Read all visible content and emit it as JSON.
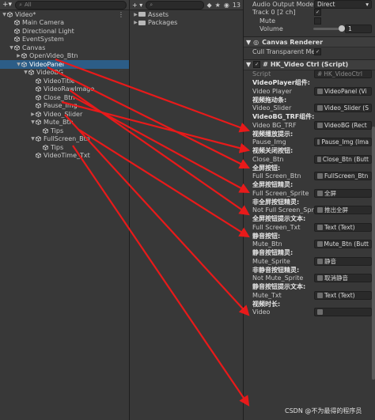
{
  "hierarchy": {
    "search_placeholder": "All",
    "rows": [
      {
        "label": "Video*",
        "depth": 0,
        "arrow": "▼",
        "icon": "scene",
        "selected": false
      },
      {
        "label": "Main Camera",
        "depth": 1,
        "arrow": "",
        "icon": "cube",
        "selected": false
      },
      {
        "label": "Directional Light",
        "depth": 1,
        "arrow": "",
        "icon": "cube",
        "selected": false
      },
      {
        "label": "EventSystem",
        "depth": 1,
        "arrow": "",
        "icon": "cube",
        "selected": false
      },
      {
        "label": "Canvas",
        "depth": 1,
        "arrow": "▼",
        "icon": "cube",
        "selected": false
      },
      {
        "label": "OpenVideo_Btn",
        "depth": 2,
        "arrow": "▶",
        "icon": "cube",
        "selected": false
      },
      {
        "label": "VideoPanel",
        "depth": 2,
        "arrow": "▼",
        "icon": "cube",
        "selected": true
      },
      {
        "label": "VideoBG",
        "depth": 3,
        "arrow": "▼",
        "icon": "cube",
        "selected": false
      },
      {
        "label": "VideoTitle",
        "depth": 4,
        "arrow": "",
        "icon": "cube",
        "selected": false
      },
      {
        "label": "VideoRawImage",
        "depth": 4,
        "arrow": "",
        "icon": "cube",
        "selected": false
      },
      {
        "label": "Close_Btn",
        "depth": 4,
        "arrow": "",
        "icon": "cube",
        "selected": false
      },
      {
        "label": "Pause_Img",
        "depth": 4,
        "arrow": "",
        "icon": "cube",
        "selected": false
      },
      {
        "label": "Video_Slider",
        "depth": 4,
        "arrow": "▶",
        "icon": "cube",
        "selected": false
      },
      {
        "label": "Mute_Btn",
        "depth": 4,
        "arrow": "▼",
        "icon": "cube",
        "selected": false
      },
      {
        "label": "Tips",
        "depth": 5,
        "arrow": "",
        "icon": "cube",
        "selected": false
      },
      {
        "label": "FullScreen_Btn",
        "depth": 4,
        "arrow": "▼",
        "icon": "cube",
        "selected": false
      },
      {
        "label": "Tips",
        "depth": 5,
        "arrow": "",
        "icon": "cube",
        "selected": false
      },
      {
        "label": "VideoTime_Txt",
        "depth": 4,
        "arrow": "",
        "icon": "cube",
        "selected": false
      }
    ]
  },
  "project": {
    "add_label": "+ ▾",
    "badge": "13",
    "folders": [
      "Assets",
      "Packages"
    ]
  },
  "inspector": {
    "audio_output_label": "Audio Output Mode",
    "audio_output_value": "Direct",
    "track_label": "Track 0 [2 ch]",
    "mute_label": "Mute",
    "volume_label": "Volume",
    "volume_value": "1",
    "volume_level": 0.88,
    "canvas_renderer_title": "Canvas Renderer",
    "cull_label": "Cull Transparent Mes",
    "script_title": "HK_Video Ctrl (Script)",
    "script_label": "Script",
    "script_value": "HK_VideoCtrl",
    "fields": [
      {
        "header": "VideoPlayer组件:",
        "label": "Video Player",
        "value": "VideoPanel (Vi"
      },
      {
        "header": "视频拖动条:",
        "label": "Video_Slider",
        "value": "Video_Slider (S"
      },
      {
        "header": "VideoBG_TRF组件:",
        "label": "Video BG_TRF",
        "value": "VideoBG (Rect"
      },
      {
        "header": "视频播放提示:",
        "label": "Pause_Img",
        "value": "Pause_Img (Ima"
      },
      {
        "header": "视频关闭按钮:",
        "label": "Close_Btn",
        "value": "Close_Btn (Butt"
      },
      {
        "header": "全屏按钮:",
        "label": "Full Screen_Btn",
        "value": "FullScreen_Btn"
      },
      {
        "header": "全屏按钮精灵:",
        "label": "Full Screen_Sprite",
        "value": "全屏"
      },
      {
        "header": "非全屏按钮精灵:",
        "label": "Not Full Screen_Sprite",
        "value": "推出全屏"
      },
      {
        "header": "全屏按钮提示文本:",
        "label": "Full Screen_Txt",
        "value": "Text (Text)"
      },
      {
        "header": "静音按钮:",
        "label": "Mute_Btn",
        "value": "Mute_Btn (Butt"
      },
      {
        "header": "静音按钮精灵:",
        "label": "Mute_Sprite",
        "value": "静音"
      },
      {
        "header": "非静音按钮精灵:",
        "label": "Not Mute_Sprite",
        "value": "取消静音"
      },
      {
        "header": "静音按钮提示文本:",
        "label": "Mute_Txt",
        "value": "Text (Text)"
      },
      {
        "header": "视频时长:",
        "label": "Video",
        "value": ""
      }
    ]
  },
  "watermark": "CSDN @不为最得的程序员",
  "colors": {
    "arrow": "#e81a1a",
    "selection": "#2c5d87"
  }
}
